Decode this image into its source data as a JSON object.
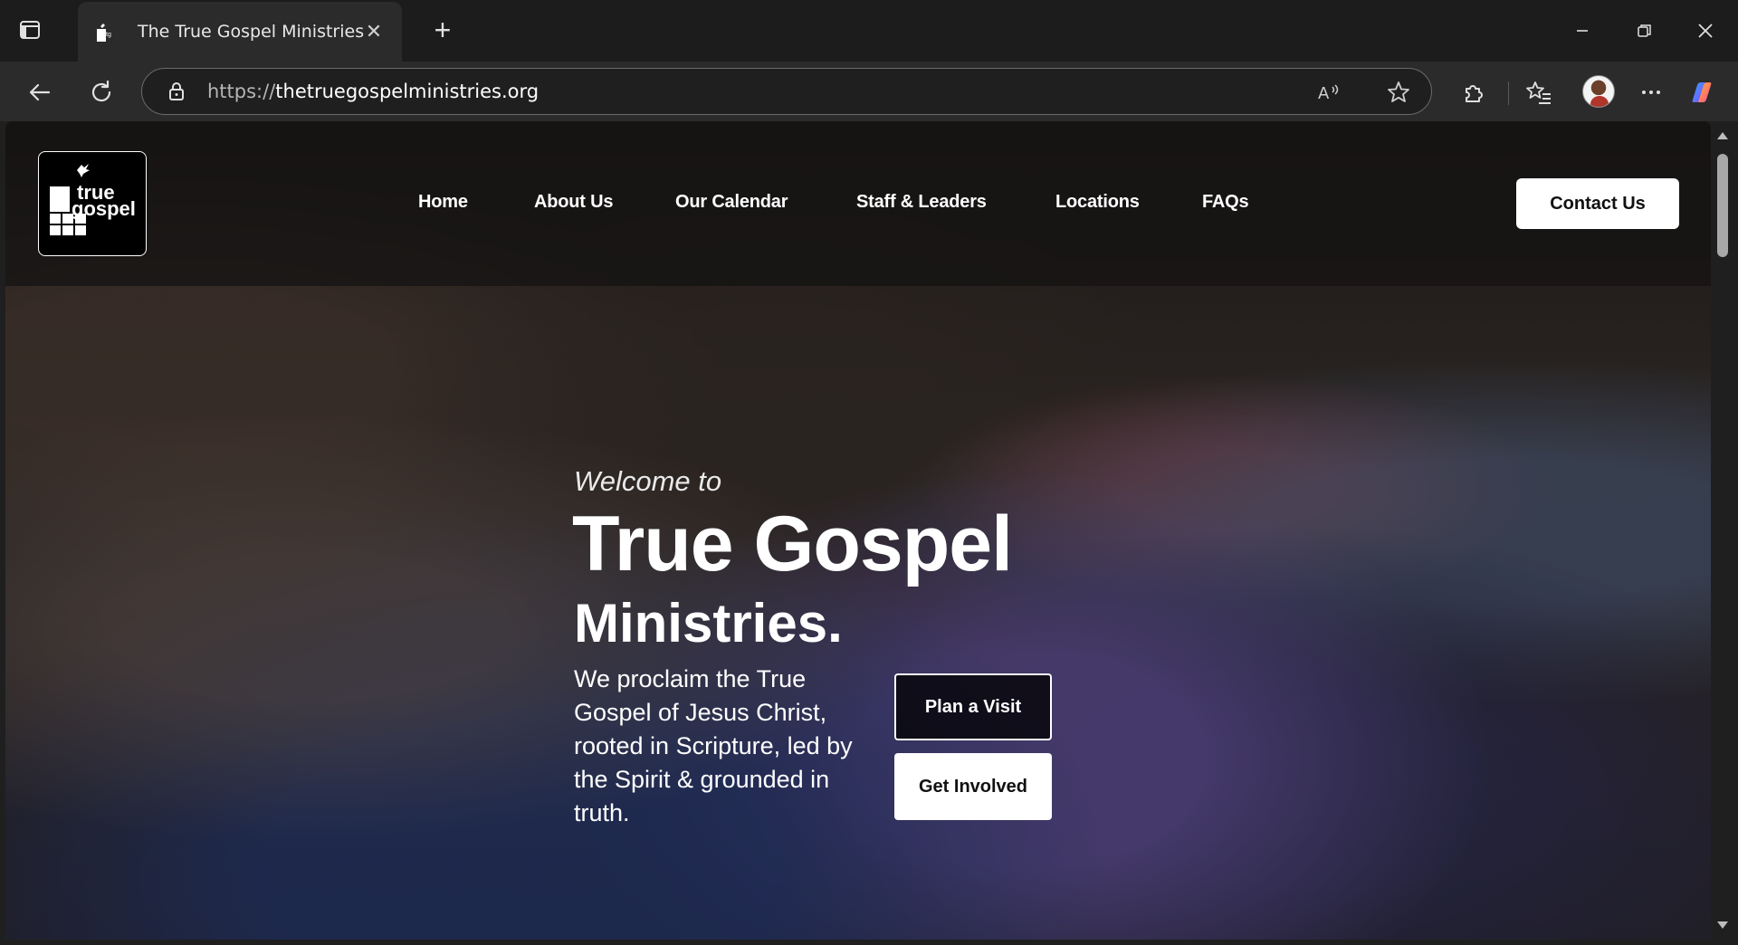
{
  "browser": {
    "tab_title": "The True Gospel Ministries",
    "tab_close_glyph": "✕",
    "new_tab_glyph": "+",
    "url_protocol": "https://",
    "url_host": "thetruegospelministries.org",
    "icons": [
      "tab-actions-icon",
      "back-arrow-icon",
      "reload-icon",
      "lock-icon",
      "read-aloud-icon",
      "star-icon",
      "extensions-icon",
      "favorites-icon",
      "profile-avatar",
      "more-icon",
      "copilot-icon",
      "minimize-icon",
      "restore-icon",
      "close-icon"
    ]
  },
  "site": {
    "logo": {
      "line1": "true",
      "line2": "gospel"
    },
    "nav": [
      "Home",
      "About Us",
      "Our Calendar",
      "Staff & Leaders",
      "Locations",
      "FAQs"
    ],
    "contact_label": "Contact Us"
  },
  "hero": {
    "welcome": "Welcome to",
    "title_line1": "True Gospel",
    "title_line2": "Ministries.",
    "description": "We proclaim the True Gospel of Jesus Christ, rooted in Scripture, led by the Spirit & grounded in truth.",
    "plan_visit_label": "Plan a Visit",
    "get_involved_label": "Get Involved"
  },
  "colors": {
    "browser_chrome": "#1c1c1c",
    "toolbar": "#2b2b2b",
    "primary_button_bg": "#ffffff",
    "primary_button_text": "#111111"
  }
}
